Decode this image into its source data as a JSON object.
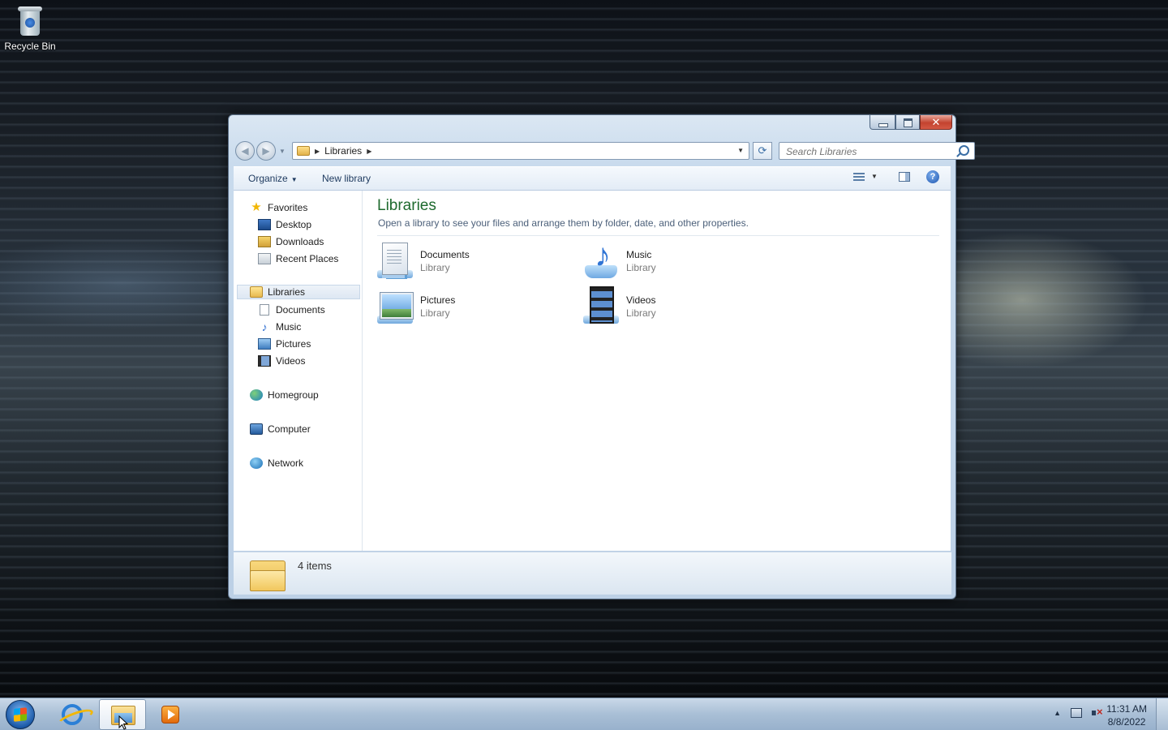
{
  "desktop": {
    "icons": [
      {
        "label": "Recycle Bin",
        "icon": "recycle-bin-icon"
      }
    ]
  },
  "window": {
    "address": {
      "crumbs": [
        "Libraries"
      ]
    },
    "search": {
      "placeholder": "Search Libraries"
    },
    "toolbar": {
      "organize": "Organize",
      "new_library": "New library"
    },
    "nav": {
      "favorites": "Favorites",
      "favorites_items": [
        "Desktop",
        "Downloads",
        "Recent Places"
      ],
      "libraries": "Libraries",
      "libraries_items": [
        "Documents",
        "Music",
        "Pictures",
        "Videos"
      ],
      "homegroup": "Homegroup",
      "computer": "Computer",
      "network": "Network"
    },
    "content": {
      "title": "Libraries",
      "subtitle": "Open a library to see your files and arrange them by folder, date, and other properties.",
      "items": [
        {
          "name": "Documents",
          "type": "Library",
          "icon": "documents-library-icon"
        },
        {
          "name": "Music",
          "type": "Library",
          "icon": "music-library-icon"
        },
        {
          "name": "Pictures",
          "type": "Library",
          "icon": "pictures-library-icon"
        },
        {
          "name": "Videos",
          "type": "Library",
          "icon": "videos-library-icon"
        }
      ]
    },
    "status": {
      "count": "4 items"
    }
  },
  "taskbar": {
    "apps": [
      "start-orb",
      "internet-explorer-icon",
      "windows-explorer-icon",
      "windows-media-player-icon"
    ],
    "clock": {
      "time": "11:31 AM",
      "date": "8/8/2022"
    }
  }
}
